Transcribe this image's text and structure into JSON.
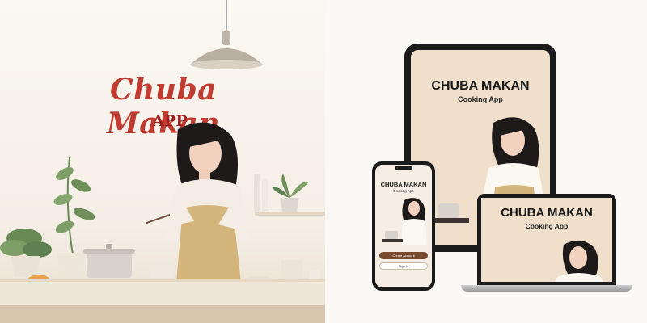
{
  "brand": {
    "title": "Chuba Makan",
    "subtitle": "APP"
  },
  "tablet": {
    "title": "CHUBA MAKAN",
    "subtitle": "Cooking App"
  },
  "phone": {
    "title": "CHUBA MAKAN",
    "subtitle": "Cooking App",
    "primary_button": "Create Account",
    "secondary_button": "Sign In"
  },
  "laptop": {
    "title": "CHUBA MAKAN",
    "subtitle": "Cooking App"
  },
  "colors": {
    "brand_red": "#c23b31",
    "screen_background": "#f0dfcb",
    "device_frame": "#1b1b1b",
    "button_brown": "#7a4a2e"
  }
}
